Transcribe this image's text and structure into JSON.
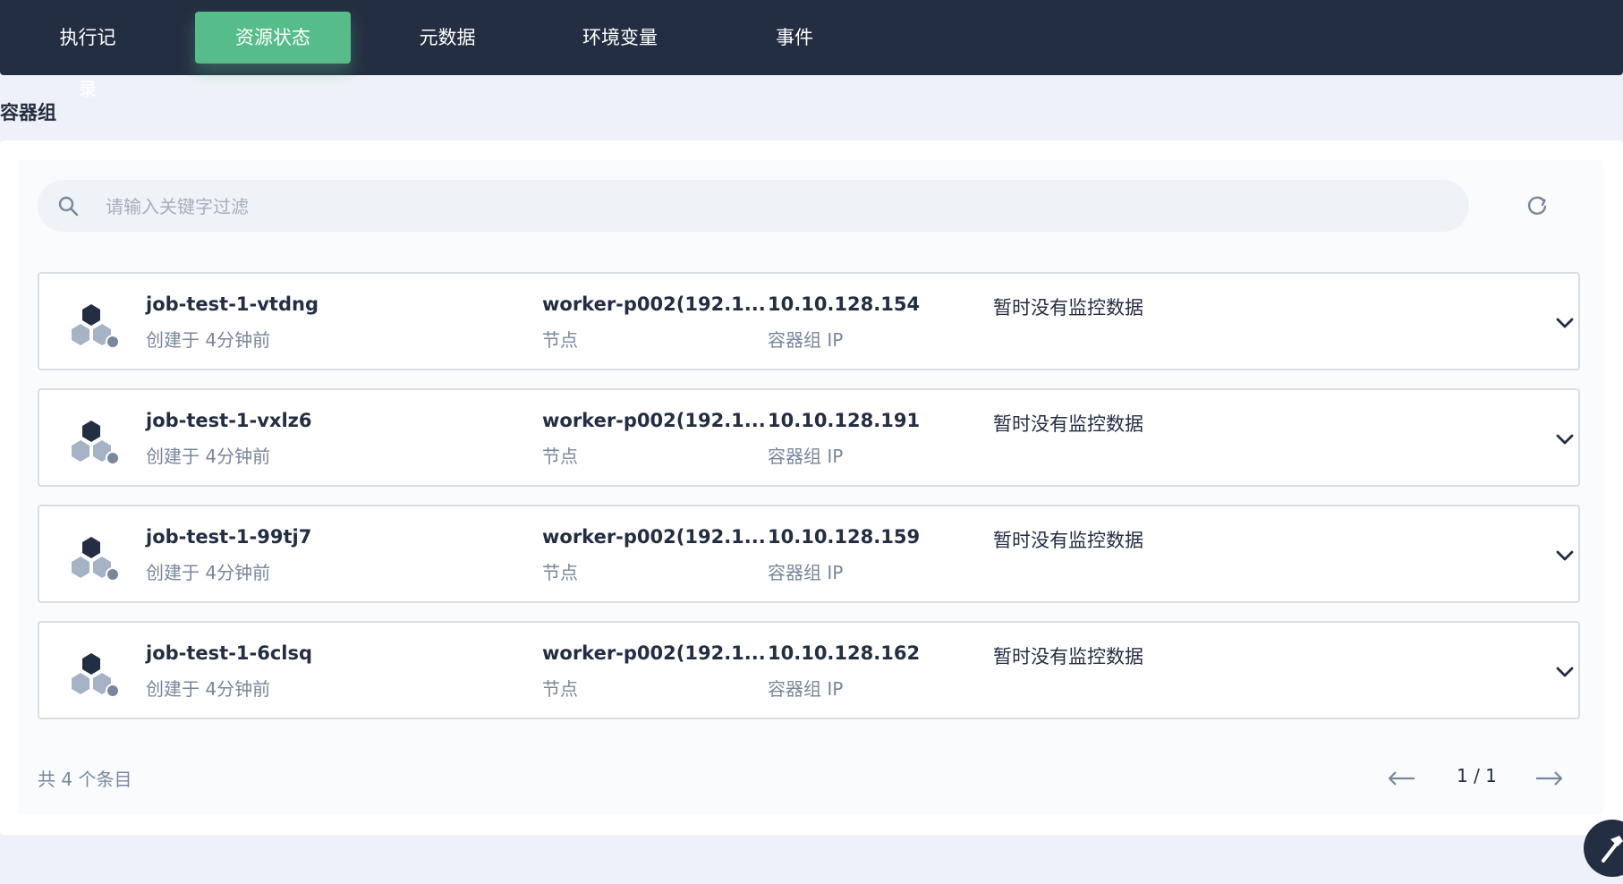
{
  "tabs": [
    {
      "label": "执行记录"
    },
    {
      "label": "资源状态"
    },
    {
      "label": "元数据"
    },
    {
      "label": "环境变量"
    },
    {
      "label": "事件"
    }
  ],
  "section_title": "容器组",
  "search": {
    "placeholder": "请输入关键字过滤"
  },
  "pods": [
    {
      "name": "job-test-1-vtdng",
      "created": "创建于 4分钟前",
      "node": "worker-p002(192.1...",
      "node_label": "节点",
      "ip": "10.10.128.154",
      "ip_label": "容器组 IP",
      "monitor": "暂时没有监控数据"
    },
    {
      "name": "job-test-1-vxlz6",
      "created": "创建于 4分钟前",
      "node": "worker-p002(192.1...",
      "node_label": "节点",
      "ip": "10.10.128.191",
      "ip_label": "容器组 IP",
      "monitor": "暂时没有监控数据"
    },
    {
      "name": "job-test-1-99tj7",
      "created": "创建于 4分钟前",
      "node": "worker-p002(192.1...",
      "node_label": "节点",
      "ip": "10.10.128.159",
      "ip_label": "容器组 IP",
      "monitor": "暂时没有监控数据"
    },
    {
      "name": "job-test-1-6clsq",
      "created": "创建于 4分钟前",
      "node": "worker-p002(192.1...",
      "node_label": "节点",
      "ip": "10.10.128.162",
      "ip_label": "容器组 IP",
      "monitor": "暂时没有监控数据"
    }
  ],
  "pagination": {
    "total": "共 4 个条目",
    "page": "1 / 1"
  },
  "colors": {
    "topbar": "#242e42",
    "active_tab": "#55bc8a",
    "muted_text": "#79879c"
  },
  "icons": {
    "search": "search-icon",
    "refresh": "refresh-icon",
    "pod": "pod-icon",
    "expand": "chevron-down-icon",
    "prev": "arrow-left-icon",
    "next": "arrow-right-icon",
    "tool": "hammer-icon"
  }
}
